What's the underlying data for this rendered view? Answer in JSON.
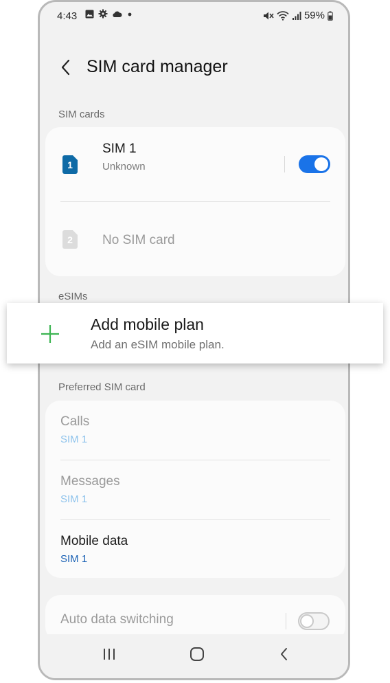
{
  "status": {
    "time": "4:43",
    "battery": "59%"
  },
  "header": {
    "title": "SIM card manager"
  },
  "sections": {
    "sim_cards": "SIM cards",
    "esims": "eSIMs",
    "preferred": "Preferred SIM card"
  },
  "sim1": {
    "badge": "1",
    "name": "SIM 1",
    "status": "Unknown",
    "enabled": true
  },
  "sim2": {
    "badge": "2",
    "label": "No SIM card"
  },
  "add_plan": {
    "title": "Add mobile plan",
    "subtitle": "Add an eSIM mobile plan."
  },
  "preferred": {
    "calls": {
      "label": "Calls",
      "value": "SIM 1"
    },
    "messages": {
      "label": "Messages",
      "value": "SIM 1"
    },
    "mobile_data": {
      "label": "Mobile data",
      "value": "SIM 1"
    }
  },
  "auto_switch": {
    "label": "Auto data switching",
    "enabled": false
  },
  "colors": {
    "accent": "#1a73e8",
    "sim_badge": "#0e6aa6",
    "plus_green": "#3db552",
    "disabled_text": "#9a9a9a",
    "disabled_value": "#8ec3ec"
  }
}
